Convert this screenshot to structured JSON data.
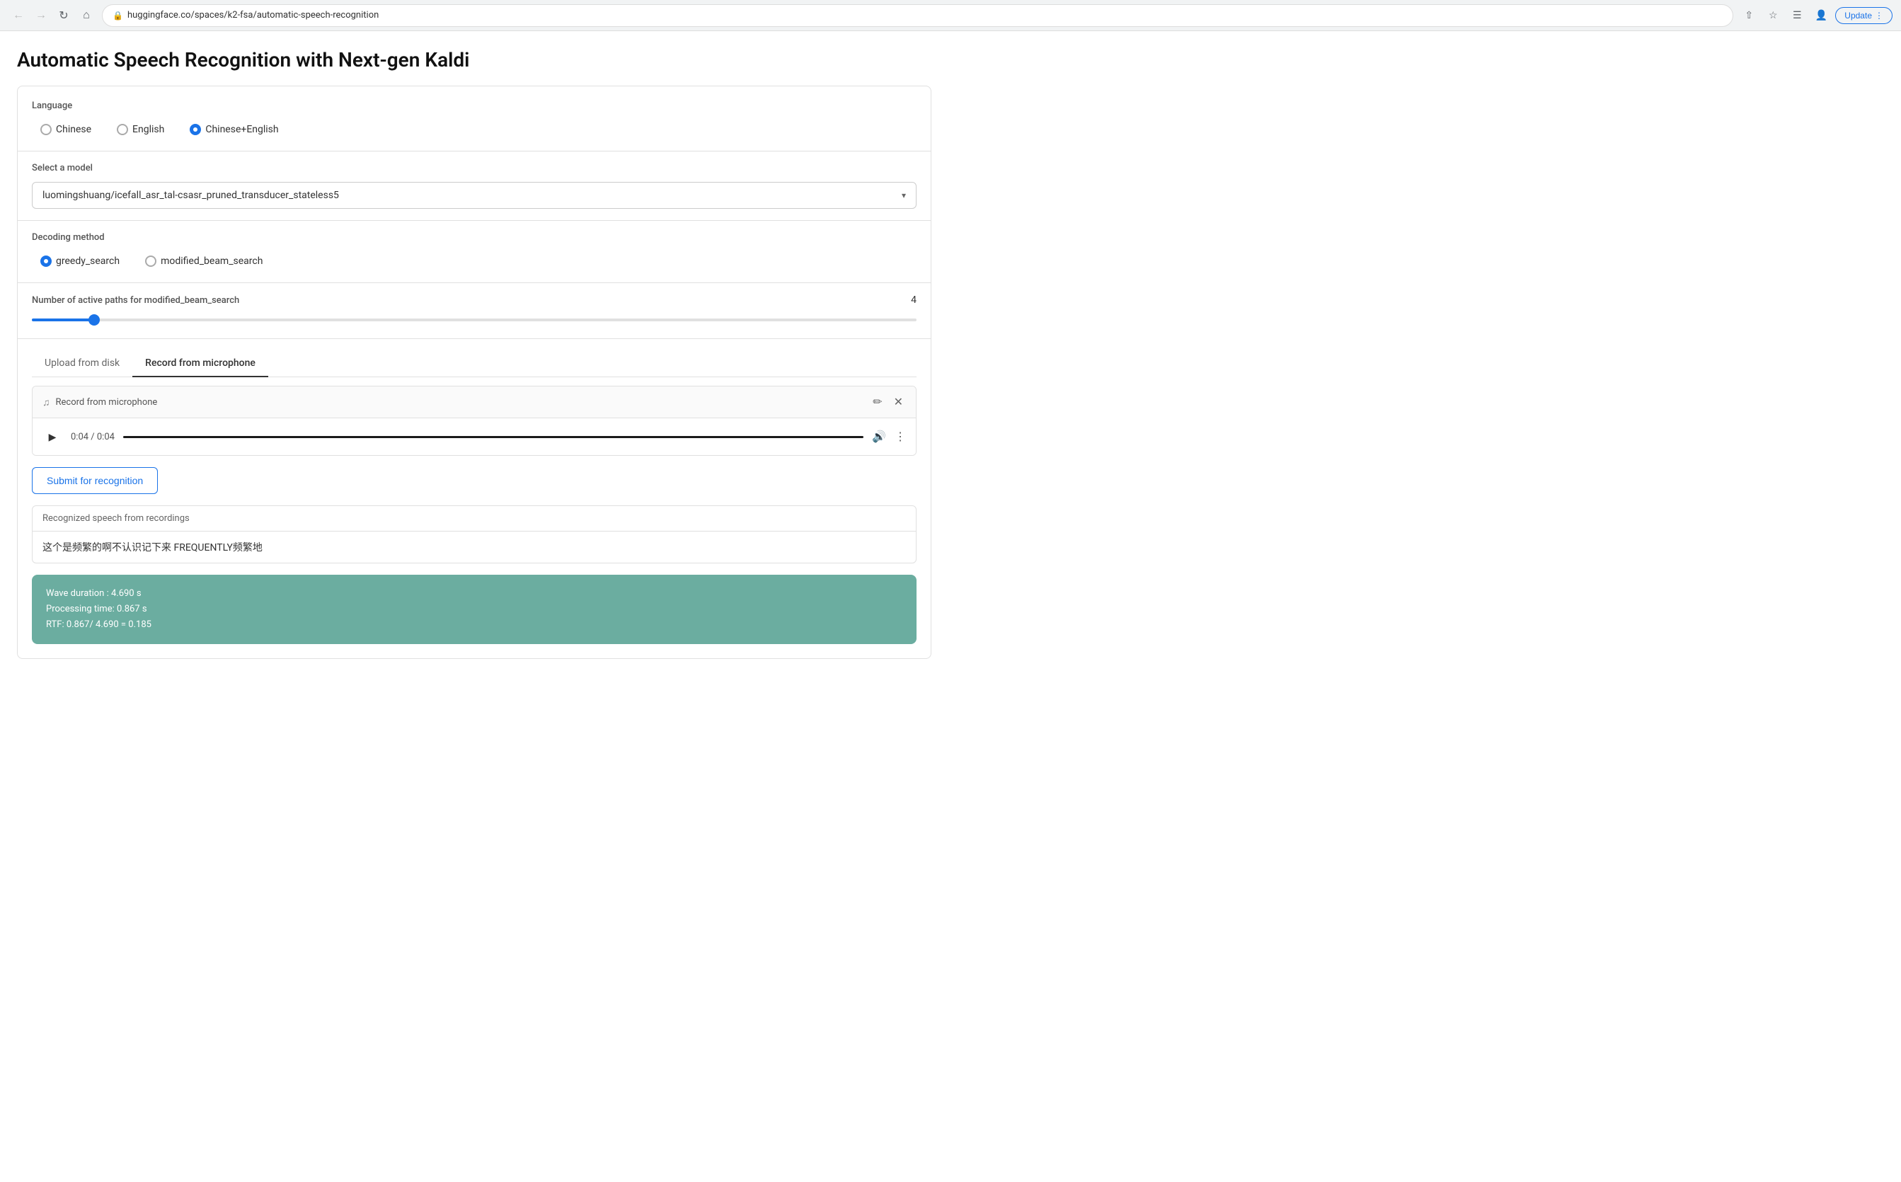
{
  "browser": {
    "url": "huggingface.co/spaces/k2-fsa/automatic-speech-recognition",
    "update_label": "Update",
    "update_dots": "⋮"
  },
  "page": {
    "title": "Automatic Speech Recognition with Next-gen Kaldi"
  },
  "language_section": {
    "label": "Language",
    "options": [
      {
        "id": "lang-chinese",
        "label": "Chinese",
        "checked": false
      },
      {
        "id": "lang-english",
        "label": "English",
        "checked": false
      },
      {
        "id": "lang-chinese-english",
        "label": "Chinese+English",
        "checked": true
      }
    ]
  },
  "model_section": {
    "label": "Select a model",
    "selected_model": "luomingshuang/icefall_asr_tal-csasr_pruned_transducer_stateless5",
    "chevron": "▾"
  },
  "decoding_section": {
    "label": "Decoding method",
    "options": [
      {
        "id": "dec-greedy",
        "label": "greedy_search",
        "checked": true
      },
      {
        "id": "dec-beam",
        "label": "modified_beam_search",
        "checked": false
      }
    ]
  },
  "beam_paths_section": {
    "label": "Number of active paths for modified_beam_search",
    "value": "4",
    "slider_percent": 7
  },
  "tabs": [
    {
      "id": "tab-upload",
      "label": "Upload from disk",
      "active": false
    },
    {
      "id": "tab-record",
      "label": "Record from microphone",
      "active": true
    }
  ],
  "audio_recorder": {
    "title": "Record from microphone",
    "time_display": "0:04 / 0:04",
    "pencil_icon": "✏",
    "close_icon": "✕",
    "play_icon": "▶",
    "volume_icon": "🔊",
    "more_icon": "⋮"
  },
  "submit_button": {
    "label": "Submit for recognition"
  },
  "recognized_section": {
    "header": "Recognized speech from recordings",
    "text": "这个是频繁的啊不认识记下来 FREQUENTLY频繁地"
  },
  "stats": {
    "wave_duration": "Wave duration : 4.690 s",
    "processing_time": "Processing time: 0.867 s",
    "rtf": "RTF: 0.867/ 4.690 = 0.185"
  }
}
